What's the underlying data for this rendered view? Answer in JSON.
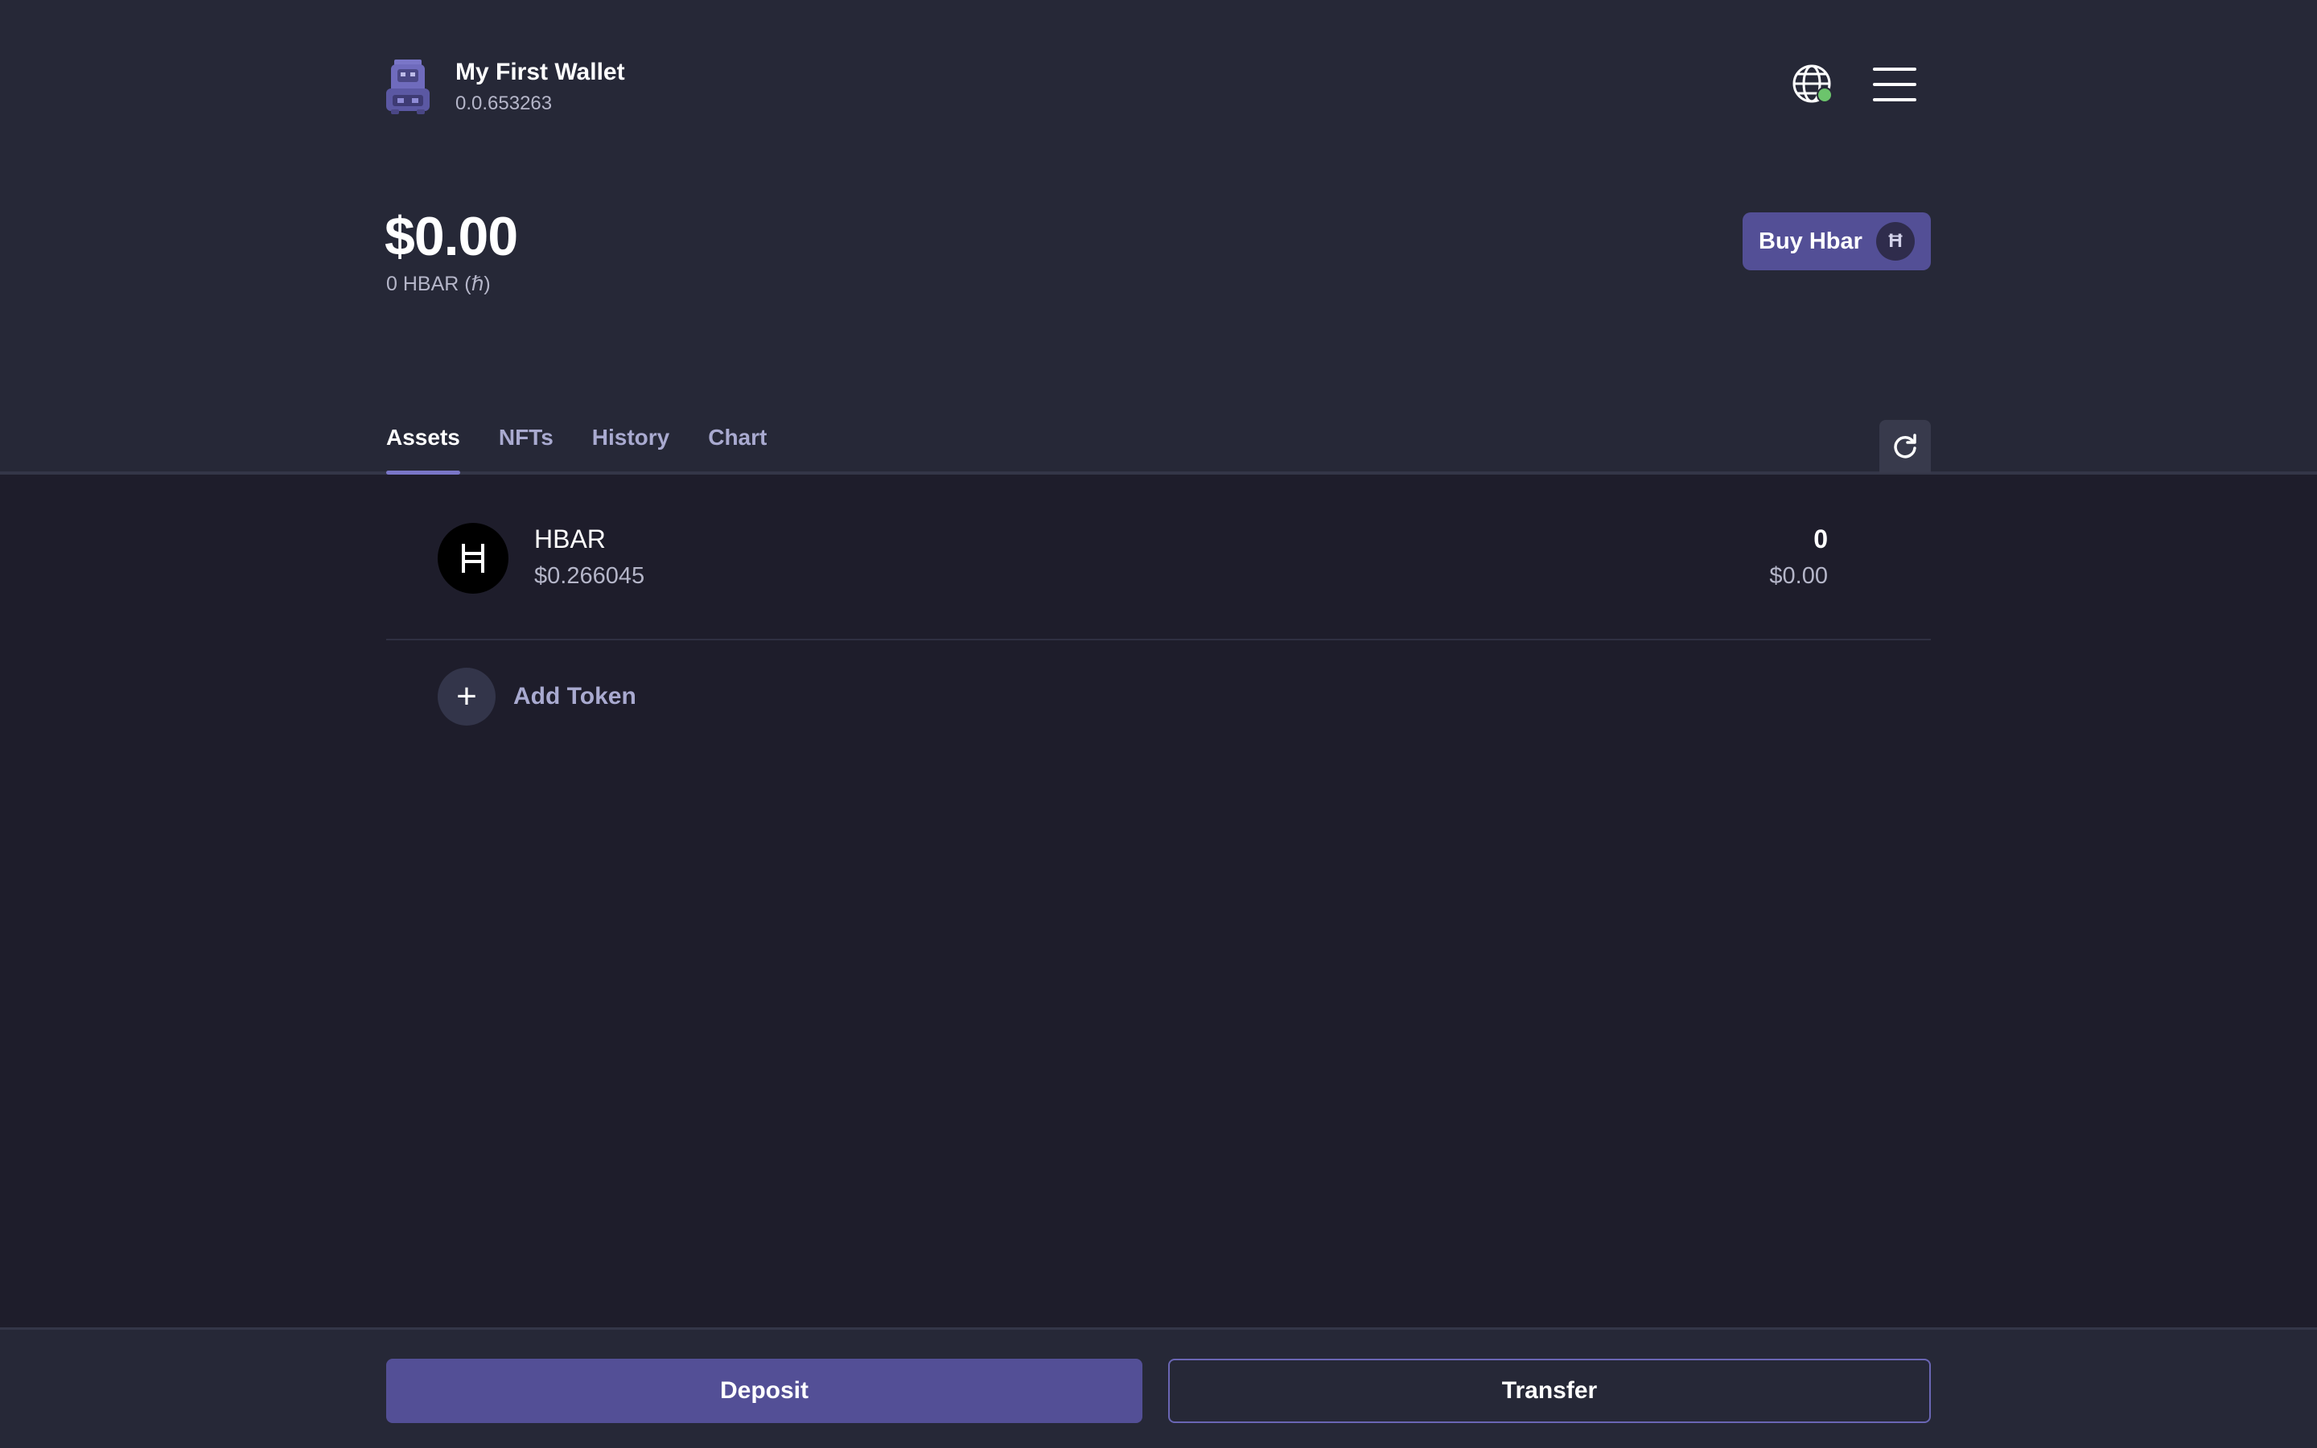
{
  "wallet": {
    "name": "My First Wallet",
    "account_id": "0.0.653263",
    "network_status_color": "#6cc46c"
  },
  "balance": {
    "usd": "$0.00",
    "hbar": "0 HBAR (ℏ)"
  },
  "buy_button": {
    "label": "Buy Hbar",
    "icon_glyph": "Ħ"
  },
  "tabs": [
    {
      "label": "Assets",
      "active": true
    },
    {
      "label": "NFTs",
      "active": false
    },
    {
      "label": "History",
      "active": false
    },
    {
      "label": "Chart",
      "active": false
    }
  ],
  "assets": [
    {
      "symbol": "HBAR",
      "price": "$0.266045",
      "amount": "0",
      "value": "$0.00",
      "icon_glyph": "Ħ"
    }
  ],
  "add_token": {
    "label": "Add Token",
    "icon_glyph": "+"
  },
  "footer": {
    "deposit_label": "Deposit",
    "transfer_label": "Transfer"
  },
  "colors": {
    "accent": "#534f96",
    "background": "#1e1d2b",
    "header_background": "#262837",
    "muted_text": "#b4b5c8"
  },
  "icons": [
    "wallet-avatar-icon",
    "globe-icon",
    "menu-icon",
    "refresh-icon",
    "hbar-icon",
    "plus-icon"
  ]
}
